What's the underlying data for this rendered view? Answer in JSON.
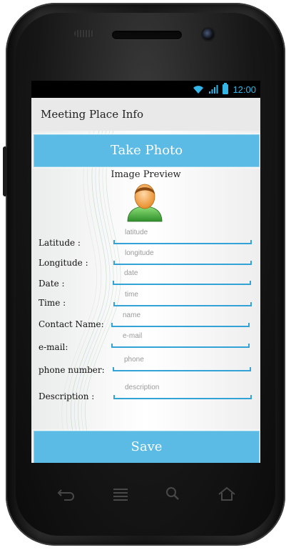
{
  "status_bar": {
    "time": "12:00"
  },
  "app": {
    "title": "Meeting Place Info"
  },
  "buttons": {
    "take_photo": "Take Photo",
    "save": "Save"
  },
  "preview": {
    "label": "Image Preview"
  },
  "fields": [
    {
      "label": "Latitude :",
      "placeholder": "latitude"
    },
    {
      "label": "Longitude :",
      "placeholder": "longitude"
    },
    {
      "label": "Date :",
      "placeholder": "date"
    },
    {
      "label": "Time :",
      "placeholder": "time"
    },
    {
      "label": "Contact Name:",
      "placeholder": "name"
    },
    {
      "label": "e-mail:",
      "placeholder": "e-mail"
    },
    {
      "label": "phone number:",
      "placeholder": "phone"
    },
    {
      "label": "Description :",
      "placeholder": "description"
    }
  ],
  "colors": {
    "accent": "#33b5e5",
    "button": "#5bbbe4",
    "underline": "#33a2d6"
  },
  "icons": [
    "wifi-icon",
    "signal-icon",
    "battery-icon",
    "avatar-icon",
    "back-icon",
    "menu-icon",
    "search-icon",
    "home-icon"
  ]
}
